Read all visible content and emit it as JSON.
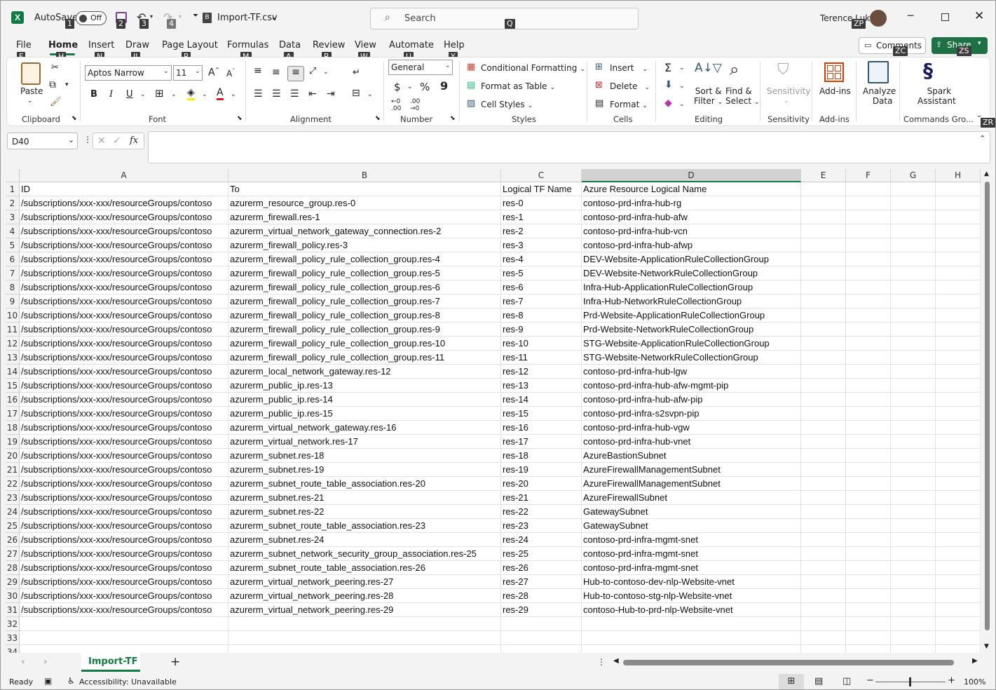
{
  "titlebar": {
    "autosave_label": "AutoSave",
    "autosave_state": "Off",
    "filename": "Import-TF.csv",
    "search_placeholder": "Search",
    "user_name": "Terence Luk",
    "keytips": {
      "autosave": "1",
      "save": "2",
      "undo": "3",
      "redo": "4",
      "search": "Q",
      "user": "ZP"
    }
  },
  "tabs": [
    {
      "label": "File",
      "keytip": "F"
    },
    {
      "label": "Home",
      "keytip": "H"
    },
    {
      "label": "Insert",
      "keytip": "N"
    },
    {
      "label": "Draw",
      "keytip": "JI"
    },
    {
      "label": "Page Layout",
      "keytip": "P"
    },
    {
      "label": "Formulas",
      "keytip": "M"
    },
    {
      "label": "Data",
      "keytip": "A"
    },
    {
      "label": "Review",
      "keytip": "R"
    },
    {
      "label": "View",
      "keytip": "W"
    },
    {
      "label": "Automate",
      "keytip": "U"
    },
    {
      "label": "Help",
      "keytip": "Y"
    }
  ],
  "header_buttons": {
    "comments": "Comments",
    "comments_keytip": "ZC",
    "share": "Share",
    "share_keytip": "ZS"
  },
  "ribbon": {
    "clipboard": {
      "paste": "Paste",
      "label": "Clipboard"
    },
    "font": {
      "name": "Aptos Narrow",
      "size": "11",
      "label": "Font",
      "bold": "B",
      "italic": "I",
      "underline": "U"
    },
    "alignment": {
      "label": "Alignment"
    },
    "number": {
      "format": "General",
      "label": "Number",
      "currency": "$",
      "percent": "%",
      "comma": "9"
    },
    "styles": {
      "conditional": "Conditional Formatting",
      "format_table": "Format as Table",
      "cell_styles": "Cell Styles",
      "label": "Styles"
    },
    "cells": {
      "insert": "Insert",
      "delete": "Delete",
      "format": "Format",
      "label": "Cells"
    },
    "editing": {
      "sort1": "Sort &",
      "sort2": "Filter",
      "find1": "Find &",
      "find2": "Select",
      "label": "Editing"
    },
    "sensitivity": {
      "button": "Sensitivity",
      "label": "Sensitivity"
    },
    "addins": {
      "button": "Add-ins",
      "label": "Add-ins"
    },
    "analyze": {
      "b1": "Analyze",
      "b2": "Data"
    },
    "spark": {
      "b1": "Spark",
      "b2": "Assistant",
      "label": "Commands Gro...",
      "keytip": "ZR"
    }
  },
  "formula_bar": {
    "name_box": "D40",
    "fx": "fx",
    "formula": ""
  },
  "columns": [
    {
      "letter": "A",
      "width": 298
    },
    {
      "letter": "B",
      "width": 389
    },
    {
      "letter": "C",
      "width": 115
    },
    {
      "letter": "D",
      "width": 313
    },
    {
      "letter": "E",
      "width": 64
    },
    {
      "letter": "F",
      "width": 64
    },
    {
      "letter": "G",
      "width": 64
    },
    {
      "letter": "H",
      "width": 64
    }
  ],
  "selected_column": "D",
  "rows": [
    [
      "ID",
      "To",
      "Logical TF Name",
      "Azure Resource Logical Name"
    ],
    [
      "/subscriptions/xxx-xxx/resourceGroups/contoso",
      "azurerm_resource_group.res-0",
      "res-0",
      "contoso-prd-infra-hub-rg"
    ],
    [
      "/subscriptions/xxx-xxx/resourceGroups/contoso",
      "azurerm_firewall.res-1",
      "res-1",
      "contoso-prd-infra-hub-afw"
    ],
    [
      "/subscriptions/xxx-xxx/resourceGroups/contoso",
      "azurerm_virtual_network_gateway_connection.res-2",
      "res-2",
      "contoso-prd-infra-hub-vcn"
    ],
    [
      "/subscriptions/xxx-xxx/resourceGroups/contoso",
      "azurerm_firewall_policy.res-3",
      "res-3",
      "contoso-prd-infra-hub-afwp"
    ],
    [
      "/subscriptions/xxx-xxx/resourceGroups/contoso",
      "azurerm_firewall_policy_rule_collection_group.res-4",
      "res-4",
      "DEV-Website-ApplicationRuleCollectionGroup"
    ],
    [
      "/subscriptions/xxx-xxx/resourceGroups/contoso",
      "azurerm_firewall_policy_rule_collection_group.res-5",
      "res-5",
      "DEV-Website-NetworkRuleCollectionGroup"
    ],
    [
      "/subscriptions/xxx-xxx/resourceGroups/contoso",
      "azurerm_firewall_policy_rule_collection_group.res-6",
      "res-6",
      "Infra-Hub-ApplicationRuleCollectionGroup"
    ],
    [
      "/subscriptions/xxx-xxx/resourceGroups/contoso",
      "azurerm_firewall_policy_rule_collection_group.res-7",
      "res-7",
      "Infra-Hub-NetworkRuleCollectionGroup"
    ],
    [
      "/subscriptions/xxx-xxx/resourceGroups/contoso",
      "azurerm_firewall_policy_rule_collection_group.res-8",
      "res-8",
      "Prd-Website-ApplicationRuleCollectionGroup"
    ],
    [
      "/subscriptions/xxx-xxx/resourceGroups/contoso",
      "azurerm_firewall_policy_rule_collection_group.res-9",
      "res-9",
      "Prd-Website-NetworkRuleCollectionGroup"
    ],
    [
      "/subscriptions/xxx-xxx/resourceGroups/contoso",
      "azurerm_firewall_policy_rule_collection_group.res-10",
      "res-10",
      "STG-Website-ApplicationRuleCollectionGroup"
    ],
    [
      "/subscriptions/xxx-xxx/resourceGroups/contoso",
      "azurerm_firewall_policy_rule_collection_group.res-11",
      "res-11",
      "STG-Website-NetworkRuleCollectionGroup"
    ],
    [
      "/subscriptions/xxx-xxx/resourceGroups/contoso",
      "azurerm_local_network_gateway.res-12",
      "res-12",
      "contoso-prd-infra-hub-lgw"
    ],
    [
      "/subscriptions/xxx-xxx/resourceGroups/contoso",
      "azurerm_public_ip.res-13",
      "res-13",
      "contoso-prd-infra-hub-afw-mgmt-pip"
    ],
    [
      "/subscriptions/xxx-xxx/resourceGroups/contoso",
      "azurerm_public_ip.res-14",
      "res-14",
      "contoso-prd-infra-hub-afw-pip"
    ],
    [
      "/subscriptions/xxx-xxx/resourceGroups/contoso",
      "azurerm_public_ip.res-15",
      "res-15",
      "contoso-prd-infra-s2svpn-pip"
    ],
    [
      "/subscriptions/xxx-xxx/resourceGroups/contoso",
      "azurerm_virtual_network_gateway.res-16",
      "res-16",
      "contoso-prd-infra-hub-vgw"
    ],
    [
      "/subscriptions/xxx-xxx/resourceGroups/contoso",
      "azurerm_virtual_network.res-17",
      "res-17",
      "contoso-prd-infra-hub-vnet"
    ],
    [
      "/subscriptions/xxx-xxx/resourceGroups/contoso",
      "azurerm_subnet.res-18",
      "res-18",
      "AzureBastionSubnet"
    ],
    [
      "/subscriptions/xxx-xxx/resourceGroups/contoso",
      "azurerm_subnet.res-19",
      "res-19",
      "AzureFirewallManagementSubnet"
    ],
    [
      "/subscriptions/xxx-xxx/resourceGroups/contoso",
      "azurerm_subnet_route_table_association.res-20",
      "res-20",
      "AzureFirewallManagementSubnet"
    ],
    [
      "/subscriptions/xxx-xxx/resourceGroups/contoso",
      "azurerm_subnet.res-21",
      "res-21",
      "AzureFirewallSubnet"
    ],
    [
      "/subscriptions/xxx-xxx/resourceGroups/contoso",
      "azurerm_subnet.res-22",
      "res-22",
      "GatewaySubnet"
    ],
    [
      "/subscriptions/xxx-xxx/resourceGroups/contoso",
      "azurerm_subnet_route_table_association.res-23",
      "res-23",
      "GatewaySubnet"
    ],
    [
      "/subscriptions/xxx-xxx/resourceGroups/contoso",
      "azurerm_subnet.res-24",
      "res-24",
      "contoso-prd-infra-mgmt-snet"
    ],
    [
      "/subscriptions/xxx-xxx/resourceGroups/contoso",
      "azurerm_subnet_network_security_group_association.res-25",
      "res-25",
      "contoso-prd-infra-mgmt-snet"
    ],
    [
      "/subscriptions/xxx-xxx/resourceGroups/contoso",
      "azurerm_subnet_route_table_association.res-26",
      "res-26",
      "contoso-prd-infra-mgmt-snet"
    ],
    [
      "/subscriptions/xxx-xxx/resourceGroups/contoso",
      "azurerm_virtual_network_peering.res-27",
      "res-27",
      "Hub-to-contoso-dev-nlp-Website-vnet"
    ],
    [
      "/subscriptions/xxx-xxx/resourceGroups/contoso",
      "azurerm_virtual_network_peering.res-28",
      "res-28",
      "Hub-to-contoso-stg-nlp-Website-vnet"
    ],
    [
      "/subscriptions/xxx-xxx/resourceGroups/contoso",
      "azurerm_virtual_network_peering.res-29",
      "res-29",
      "contoso-Hub-to-prd-nlp-Website-vnet"
    ],
    [
      "",
      "",
      "",
      ""
    ],
    [
      "",
      "",
      "",
      ""
    ],
    [
      "",
      "",
      "",
      ""
    ]
  ],
  "sheets": [
    {
      "name": "Import-TF",
      "active": true
    }
  ],
  "status": {
    "ready": "Ready",
    "accessibility": "Accessibility: Unavailable",
    "zoom": "100%"
  },
  "colors": {
    "excel_green": "#1e7145",
    "accent_green": "#107c41",
    "selection": "#e8e8e8"
  }
}
